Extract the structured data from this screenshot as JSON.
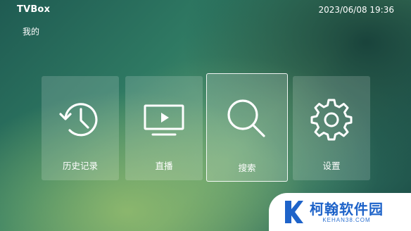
{
  "header": {
    "app_title": "TVBox",
    "datetime": "2023/06/08 19:36"
  },
  "section": {
    "label": "我的"
  },
  "tiles": [
    {
      "label": "历史记录",
      "icon": "history-icon",
      "focused": false
    },
    {
      "label": "直播",
      "icon": "tv-play-icon",
      "focused": false
    },
    {
      "label": "搜索",
      "icon": "search-icon",
      "focused": true
    },
    {
      "label": "设置",
      "icon": "gear-icon",
      "focused": false
    }
  ],
  "watermark": {
    "name": "柯翰软件园",
    "url": "KEHAN38.COM",
    "color": "#1e63c9"
  }
}
